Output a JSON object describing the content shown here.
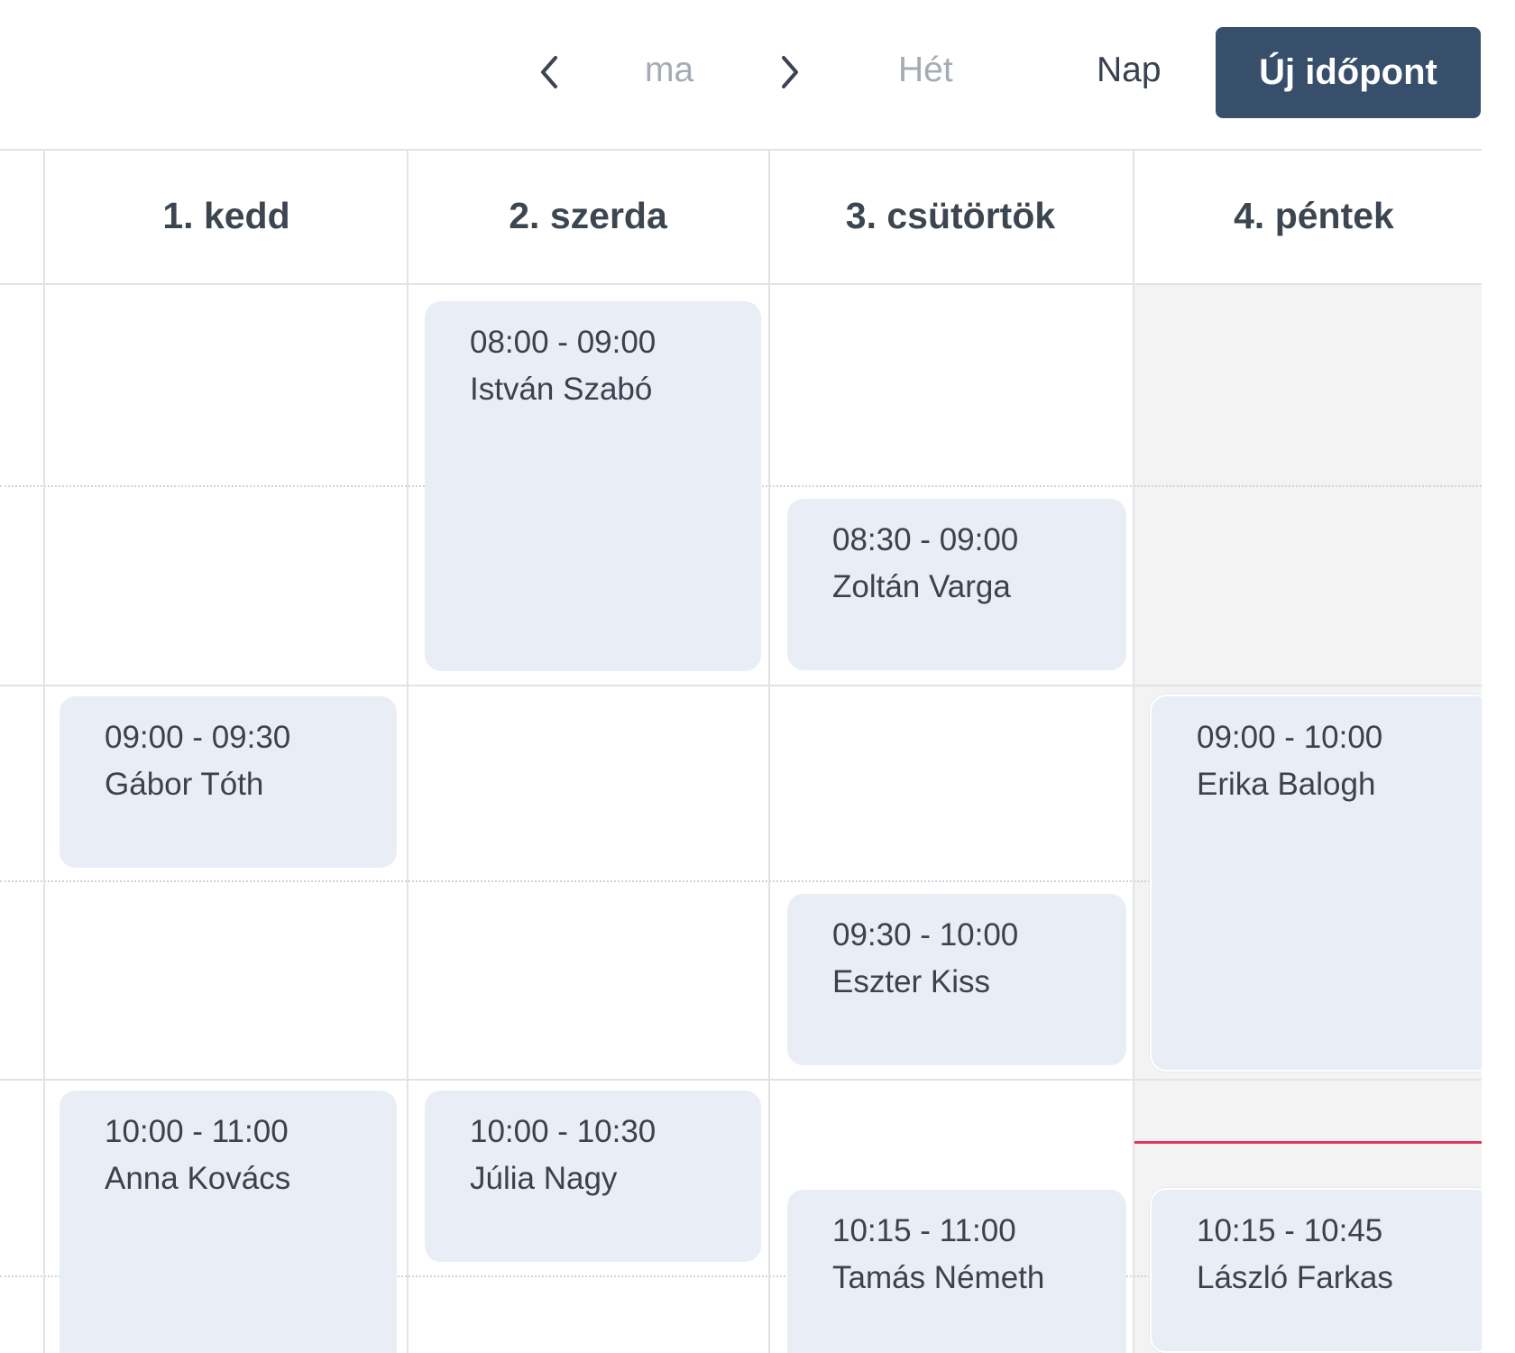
{
  "toolbar": {
    "prev_icon": "chevron-left-icon",
    "today_label": "ma",
    "next_icon": "chevron-right-icon",
    "week_label": "Hét",
    "day_label": "Nap",
    "new_appointment_label": "Új időpont",
    "accent_color": "#384f6b"
  },
  "days": [
    {
      "label": "1. kedd"
    },
    {
      "label": "2. szerda"
    },
    {
      "label": "3. csütörtök"
    },
    {
      "label": "4. péntek"
    }
  ],
  "events": [
    {
      "day": "2. szerda",
      "time": "08:00 - 09:00",
      "name": "István Szabó"
    },
    {
      "day": "3. csütörtök",
      "time": "08:30 - 09:00",
      "name": "Zoltán Varga"
    },
    {
      "day": "1. kedd",
      "time": "09:00 - 09:30",
      "name": "Gábor Tóth"
    },
    {
      "day": "4. péntek",
      "time": "09:00 - 10:00",
      "name": "Erika Balogh"
    },
    {
      "day": "3. csütörtök",
      "time": "09:30 - 10:00",
      "name": "Eszter Kiss"
    },
    {
      "day": "1. kedd",
      "time": "10:00 - 11:00",
      "name": "Anna Kovács"
    },
    {
      "day": "2. szerda",
      "time": "10:00 - 10:30",
      "name": "Júlia Nagy"
    },
    {
      "day": "3. csütörtök",
      "time": "10:15 - 11:00",
      "name": "Tamás Németh"
    },
    {
      "day": "4. péntek",
      "time": "10:15 - 10:45",
      "name": "László Farkas"
    }
  ],
  "colors": {
    "event_bg": "#e9edf6",
    "past_bg": "#f3f3f3",
    "now_indicator": "#e0335e"
  }
}
